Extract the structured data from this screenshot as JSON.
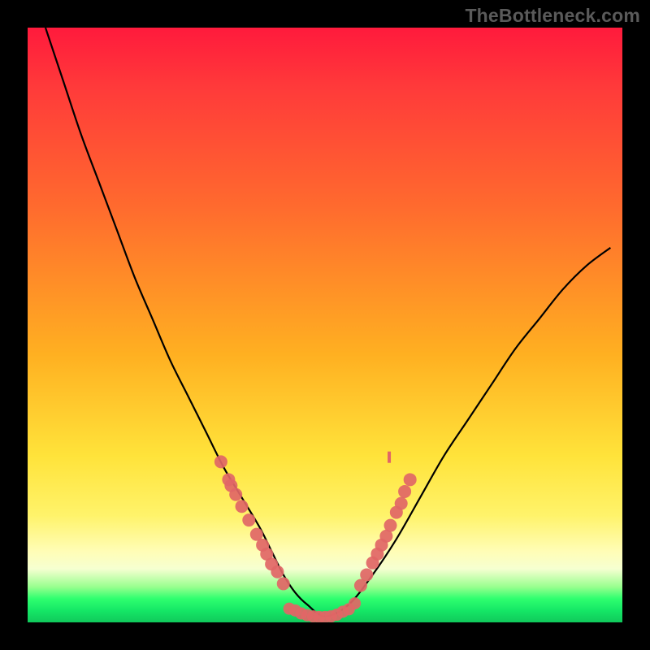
{
  "watermark": "TheBottleneck.com",
  "colors": {
    "background": "#000000",
    "gradient_top": "#ff1a3c",
    "gradient_mid": "#ffe33a",
    "gradient_bottom": "#10c95b",
    "curve": "#000000",
    "dots": "#e16666"
  },
  "chart_data": {
    "type": "line",
    "title": "",
    "xlabel": "",
    "ylabel": "",
    "xlim": [
      0,
      100
    ],
    "ylim": [
      0,
      100
    ],
    "grid": false,
    "legend": false,
    "series": [
      {
        "name": "bottleneck-curve",
        "x": [
          3,
          6,
          9,
          12,
          15,
          18,
          21,
          24,
          27,
          30,
          33,
          36,
          39,
          41,
          43,
          45,
          47,
          50,
          54,
          58,
          62,
          66,
          70,
          74,
          78,
          82,
          86,
          90,
          94,
          98
        ],
        "y": [
          100,
          91,
          82,
          74,
          66,
          58,
          51,
          44,
          38,
          32,
          26,
          21,
          16,
          12,
          8,
          5,
          3,
          1,
          3,
          8,
          14,
          21,
          28,
          34,
          40,
          46,
          51,
          56,
          60,
          63
        ]
      }
    ],
    "dots_left": [
      {
        "x": 32.5,
        "y": 27
      },
      {
        "x": 33.8,
        "y": 24
      },
      {
        "x": 34.2,
        "y": 23
      },
      {
        "x": 35.0,
        "y": 21.5
      },
      {
        "x": 36.0,
        "y": 19.5
      },
      {
        "x": 37.2,
        "y": 17.2
      },
      {
        "x": 38.5,
        "y": 14.8
      },
      {
        "x": 39.5,
        "y": 13.0
      },
      {
        "x": 40.2,
        "y": 11.5
      },
      {
        "x": 41.0,
        "y": 9.8
      },
      {
        "x": 42.0,
        "y": 8.5
      },
      {
        "x": 43.0,
        "y": 6.5
      }
    ],
    "dots_right": [
      {
        "x": 56.0,
        "y": 6.2
      },
      {
        "x": 57.0,
        "y": 8.0
      },
      {
        "x": 58.0,
        "y": 10.0
      },
      {
        "x": 58.8,
        "y": 11.5
      },
      {
        "x": 59.5,
        "y": 13.0
      },
      {
        "x": 60.3,
        "y": 14.5
      },
      {
        "x": 61.0,
        "y": 16.3
      },
      {
        "x": 62.0,
        "y": 18.5
      },
      {
        "x": 62.8,
        "y": 20.0
      },
      {
        "x": 63.4,
        "y": 22.0
      },
      {
        "x": 64.3,
        "y": 24.0
      }
    ],
    "dots_bottom": [
      {
        "x": 44.0,
        "y": 2.3
      },
      {
        "x": 45.0,
        "y": 2.0
      },
      {
        "x": 46.0,
        "y": 1.5
      },
      {
        "x": 47.0,
        "y": 1.2
      },
      {
        "x": 48.0,
        "y": 1.0
      },
      {
        "x": 49.0,
        "y": 0.9
      },
      {
        "x": 50.0,
        "y": 0.9
      },
      {
        "x": 51.0,
        "y": 1.0
      },
      {
        "x": 52.0,
        "y": 1.3
      },
      {
        "x": 53.0,
        "y": 1.8
      },
      {
        "x": 54.0,
        "y": 2.2
      },
      {
        "x": 55.0,
        "y": 3.2
      }
    ],
    "tick_mark": {
      "x": 60.8,
      "y": 27.5
    }
  }
}
